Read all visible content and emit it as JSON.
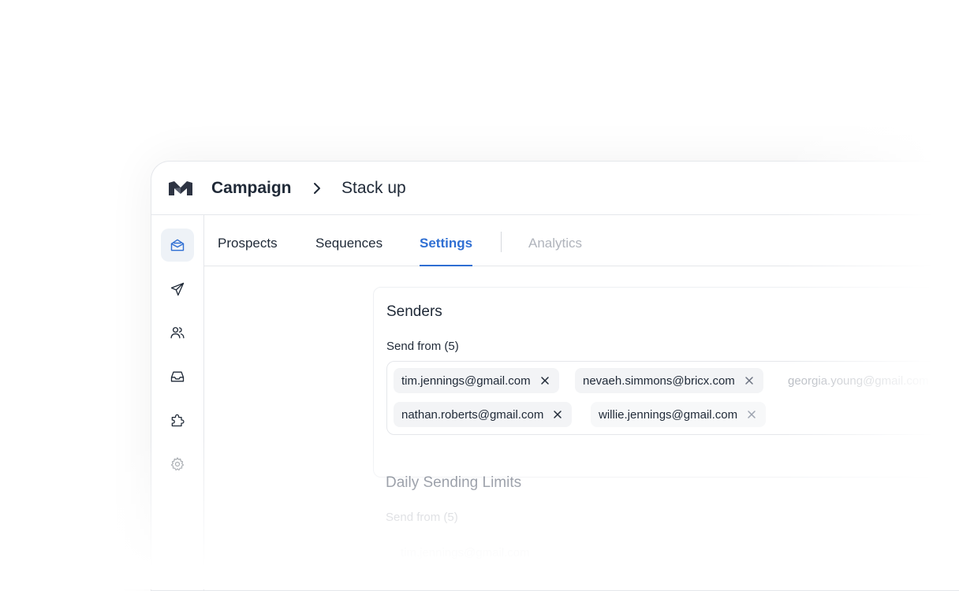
{
  "header": {
    "breadcrumb_root": "Campaign",
    "breadcrumb_current": "Stack up"
  },
  "sidebar": {
    "items": [
      {
        "icon": "mail-open-icon",
        "active": true
      },
      {
        "icon": "send-icon",
        "active": false
      },
      {
        "icon": "users-icon",
        "active": false
      },
      {
        "icon": "inbox-icon",
        "active": false
      },
      {
        "icon": "puzzle-icon",
        "active": false
      },
      {
        "icon": "gear-icon",
        "active": false
      }
    ]
  },
  "tabs": [
    {
      "label": "Prospects",
      "state": "normal"
    },
    {
      "label": "Sequences",
      "state": "normal"
    },
    {
      "label": "Settings",
      "state": "active"
    },
    {
      "label": "Analytics",
      "state": "disabled"
    }
  ],
  "senders": {
    "title": "Senders",
    "field_label": "Send from (5)",
    "chips": [
      "tim.jennings@gmail.com",
      "nevaeh.simmons@bricx.com",
      "georgia.young@gmail.com",
      "nathan.roberts@gmail.com",
      "willie.jennings@gmail.com"
    ]
  },
  "daily_limits": {
    "title": "Daily Sending Limits",
    "field_label": "Send from (5)",
    "ghost_text": "tim.jennings@gmail.com"
  },
  "colors": {
    "accent": "#2f6fd3",
    "text": "#1f2937",
    "muted": "#b0b4bc",
    "border": "#e5e7eb"
  }
}
